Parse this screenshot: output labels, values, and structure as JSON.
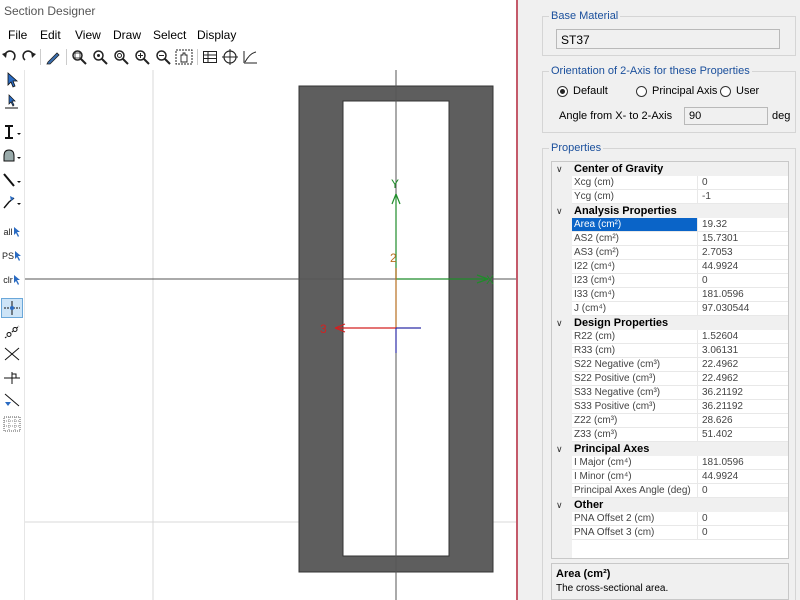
{
  "window": {
    "title": "Section Designer"
  },
  "menu": [
    "File",
    "Edit",
    "View",
    "Draw",
    "Select",
    "Display"
  ],
  "toolbar": {
    "icons": [
      "undo-icon",
      "redo-icon",
      "pencil-icon",
      "zoom-icon",
      "zoom-in-icon",
      "zoom-out-icon",
      "zoom-plus-icon",
      "zoom-minus-icon",
      "pan-icon",
      "table-icon",
      "crosshair-icon",
      "curve-icon"
    ]
  },
  "left_tools": {
    "items": [
      {
        "name": "pointer-tool-icon",
        "label": ""
      },
      {
        "name": "reshape-tool-icon",
        "label": ""
      },
      {
        "name": "draw-section-icon",
        "label": ""
      },
      {
        "name": "draw-shape-icon",
        "label": ""
      },
      {
        "name": "draw-line-icon",
        "label": ""
      },
      {
        "name": "draw-polyline-icon",
        "label": ""
      },
      {
        "name": "select-all-icon",
        "label": "all"
      },
      {
        "name": "select-previous-icon",
        "label": "PS"
      },
      {
        "name": "clear-selection-icon",
        "label": "clr"
      },
      {
        "name": "snap-point-icon",
        "label": ""
      },
      {
        "name": "snap-line-icon",
        "label": ""
      },
      {
        "name": "snap-intersection-icon",
        "label": ""
      },
      {
        "name": "snap-perpendicular-icon",
        "label": ""
      },
      {
        "name": "snap-edge-icon",
        "label": ""
      },
      {
        "name": "snap-grid-icon",
        "label": ""
      }
    ]
  },
  "canvas": {
    "axis_labels": {
      "x": "X",
      "y": "Y",
      "axis2": "2",
      "axis3": "3"
    }
  },
  "base_material": {
    "title": "Base Material",
    "value": "ST37"
  },
  "orientation": {
    "title": "Orientation of 2-Axis for these Properties",
    "options": [
      "Default",
      "Principal Axis",
      "User"
    ],
    "selected": "Default",
    "angle_label": "Angle from X-  to 2-Axis",
    "angle_value": "90",
    "angle_unit": "deg"
  },
  "properties": {
    "title": "Properties",
    "categories": [
      {
        "name": "Center of Gravity",
        "rows": [
          {
            "label": "Xcg (cm)",
            "value": "0"
          },
          {
            "label": "Ycg (cm)",
            "value": "-1"
          }
        ]
      },
      {
        "name": "Analysis Properties",
        "rows": [
          {
            "label": "Area (cm²)",
            "value": "19.32",
            "selected": true
          },
          {
            "label": "AS2 (cm²)",
            "value": "15.7301"
          },
          {
            "label": "AS3 (cm²)",
            "value": "2.7053"
          },
          {
            "label": "I22 (cm⁴)",
            "value": "44.9924"
          },
          {
            "label": "I23 (cm⁴)",
            "value": "0"
          },
          {
            "label": "I33 (cm⁴)",
            "value": "181.0596"
          },
          {
            "label": "J (cm⁴)",
            "value": "97.030544"
          }
        ]
      },
      {
        "name": "Design Properties",
        "rows": [
          {
            "label": "R22 (cm)",
            "value": "1.52604"
          },
          {
            "label": "R33 (cm)",
            "value": "3.06131"
          },
          {
            "label": "S22 Negative (cm³)",
            "value": "22.4962"
          },
          {
            "label": "S22 Positive (cm³)",
            "value": "22.4962"
          },
          {
            "label": "S33 Negative (cm³)",
            "value": "36.21192"
          },
          {
            "label": "S33 Positive (cm³)",
            "value": "36.21192"
          },
          {
            "label": "Z22 (cm³)",
            "value": "28.626"
          },
          {
            "label": "Z33 (cm³)",
            "value": "51.402"
          }
        ]
      },
      {
        "name": "Principal Axes",
        "rows": [
          {
            "label": "I Major (cm⁴)",
            "value": "181.0596"
          },
          {
            "label": "I Minor (cm⁴)",
            "value": "44.9924"
          },
          {
            "label": "Principal Axes Angle (deg)",
            "value": "0"
          }
        ]
      },
      {
        "name": "Other",
        "rows": [
          {
            "label": "PNA Offset 2 (cm)",
            "value": "0"
          },
          {
            "label": "PNA Offset 3 (cm)",
            "value": "0"
          }
        ]
      }
    ]
  },
  "description": {
    "title": "Area (cm²)",
    "text": "The cross-sectional area."
  },
  "colors": {
    "section_fill": "#5e5e5e",
    "axis_x": "#1f8c2a",
    "axis_y": "#1f8c2a",
    "axis_2": "#b86e1e",
    "axis_3": "#d42020",
    "axis_blue": "#2d2da8",
    "accent": "#1a4f9c",
    "selection": "#0a64c8",
    "divider": "#c45a6a"
  }
}
